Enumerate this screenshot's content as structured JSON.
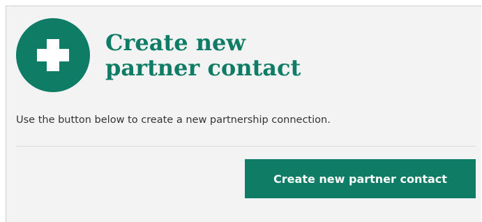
{
  "card": {
    "title": "Create new partner contact",
    "icon": "plus-circle-icon",
    "description": "Use the button below to create a new partnership connection.",
    "button_label": "Create new partner contact"
  },
  "colors": {
    "brand_green": "#0f7c66",
    "background": "#f3f3f3",
    "text": "#333333"
  }
}
